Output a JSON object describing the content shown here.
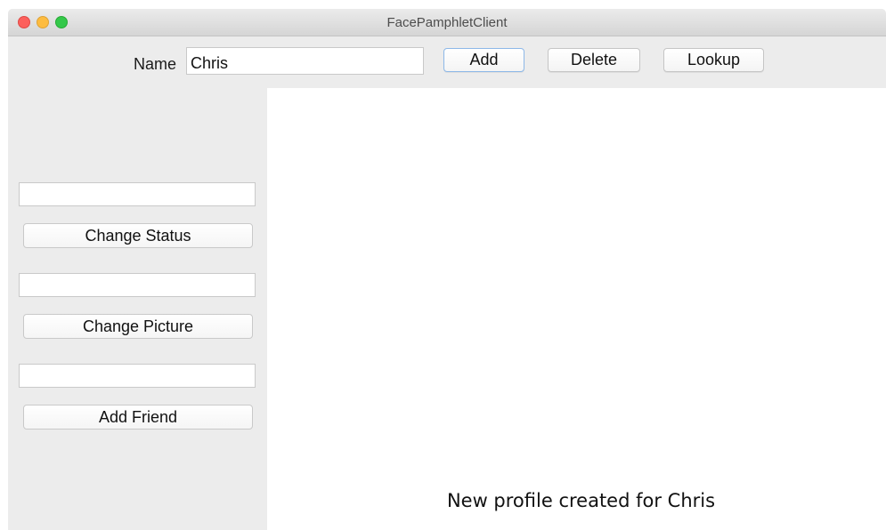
{
  "window": {
    "title": "FacePamphletClient"
  },
  "toolbar": {
    "name_label": "Name",
    "name_value": "Chris",
    "add_label": "Add",
    "delete_label": "Delete",
    "lookup_label": "Lookup"
  },
  "sidebar": {
    "status_field_value": "",
    "change_status_label": "Change Status",
    "picture_field_value": "",
    "change_picture_label": "Change Picture",
    "friend_field_value": "",
    "add_friend_label": "Add Friend"
  },
  "canvas": {
    "message": "New profile created for Chris"
  },
  "colors": {
    "traffic_close": "#fc605c",
    "traffic_minimize": "#fdbc40",
    "traffic_maximize": "#34c84a",
    "focus_ring": "#8db8e8"
  }
}
